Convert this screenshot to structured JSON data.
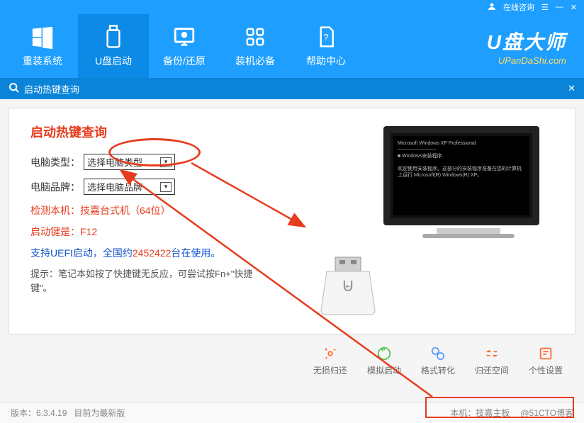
{
  "titlebar": {
    "consult": "在线咨询",
    "menu": "☰",
    "min": "—",
    "close": "✕"
  },
  "nav": [
    {
      "label": "重装系统"
    },
    {
      "label": "U盘启动"
    },
    {
      "label": "备份/还原"
    },
    {
      "label": "装机必备"
    },
    {
      "label": "帮助中心"
    }
  ],
  "logo": {
    "title": "U盘大师",
    "url": "UPanDaShi.com"
  },
  "subheader": {
    "title": "启动热键查询"
  },
  "main": {
    "title": "启动热键查询",
    "type_label": "电脑类型：",
    "type_select": "选择电脑类型",
    "brand_label": "电脑品牌：",
    "brand_select": "选择电脑品牌",
    "detect_label": "检测本机：",
    "detect_value": "技嘉台式机（64位）",
    "bootkey_label": "启动键是：",
    "bootkey_value": "F12",
    "uefi_prefix": "支持UEFI启动，全国约",
    "uefi_count": "2452422",
    "uefi_suffix": "台在使用。",
    "hint": "提示：笔记本如按了快捷键无反应，可尝试按Fn+\"快捷键\"。"
  },
  "tools": [
    {
      "label": "无损归还",
      "color": "#ff6b35"
    },
    {
      "label": "模拟启动",
      "color": "#56c456"
    },
    {
      "label": "格式转化",
      "color": "#5b9eff"
    },
    {
      "label": "归还空间",
      "color": "#ff6b35"
    },
    {
      "label": "个性设置",
      "color": "#ff6b35"
    }
  ],
  "footer": {
    "version_label": "版本：",
    "version": "6.3.4.19",
    "latest": "目前为最新版",
    "machine_label": "本机：",
    "machine": "技嘉主板",
    "watermark": "@51CTO博客"
  }
}
